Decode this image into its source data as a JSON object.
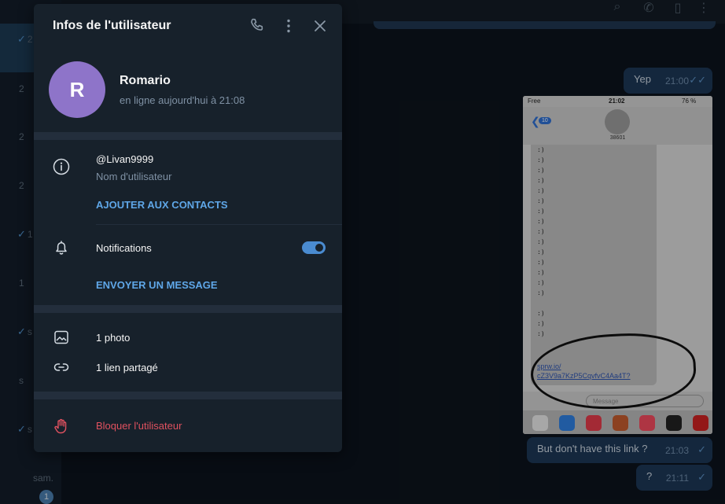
{
  "panel": {
    "title": "Infos de l'utilisateur",
    "user": {
      "initial": "R",
      "name": "Romario",
      "status": "en ligne aujourd'hui à 21:08",
      "avatar_color": "#8e74c9"
    },
    "info": {
      "username": "@Livan9999",
      "username_caption": "Nom d'utilisateur",
      "add_contact": "AJOUTER AUX CONTACTS"
    },
    "notifications": {
      "label": "Notifications",
      "enabled": true,
      "send_message": "ENVOYER UN MESSAGE"
    },
    "media": {
      "photos": "1 photo",
      "links": "1 lien partagé"
    },
    "block": "Bloquer l'utilisateur",
    "colors": {
      "accent": "#5fa7e8",
      "danger": "#e0515f",
      "background": "#17212b"
    }
  },
  "chat_list": {
    "items": [
      {
        "check": "✓",
        "text": "2"
      },
      {
        "check": "",
        "text": "2"
      },
      {
        "check": "",
        "text": "2"
      },
      {
        "check": "",
        "text": "2"
      },
      {
        "check": "✓",
        "text": "1"
      },
      {
        "check": "",
        "text": "1"
      },
      {
        "check": "✓",
        "text": "s"
      },
      {
        "check": "",
        "text": "s"
      },
      {
        "check": "✓",
        "text": "s"
      },
      {
        "check": "",
        "text": "sam."
      }
    ],
    "badge": "1"
  },
  "chat": {
    "messages": [
      {
        "text": "Yep",
        "time": "21:00",
        "check": "✓✓"
      },
      {
        "text": "But don't have this link ?",
        "time": "21:03",
        "check": "✓"
      },
      {
        "text": "?",
        "time": "21:11",
        "check": "✓"
      }
    ],
    "phone": {
      "carrier": "Free",
      "clock": "21:02",
      "battery": "76 %",
      "back_count": "10",
      "contact_number": "38601",
      "smileys": [
        ":)",
        ":)",
        ":)",
        ":)",
        ":)",
        ":)",
        ":)",
        ":)",
        ":)",
        ":)",
        ":)",
        ":)",
        ":)",
        ":)",
        ":)",
        "",
        ":)",
        ":)",
        ":)"
      ],
      "link_line1": "sprw.io/",
      "link_line2": "cZ3V9a7KzP5CqvfvC4Aa4T?",
      "input_placeholder": "Message"
    }
  }
}
